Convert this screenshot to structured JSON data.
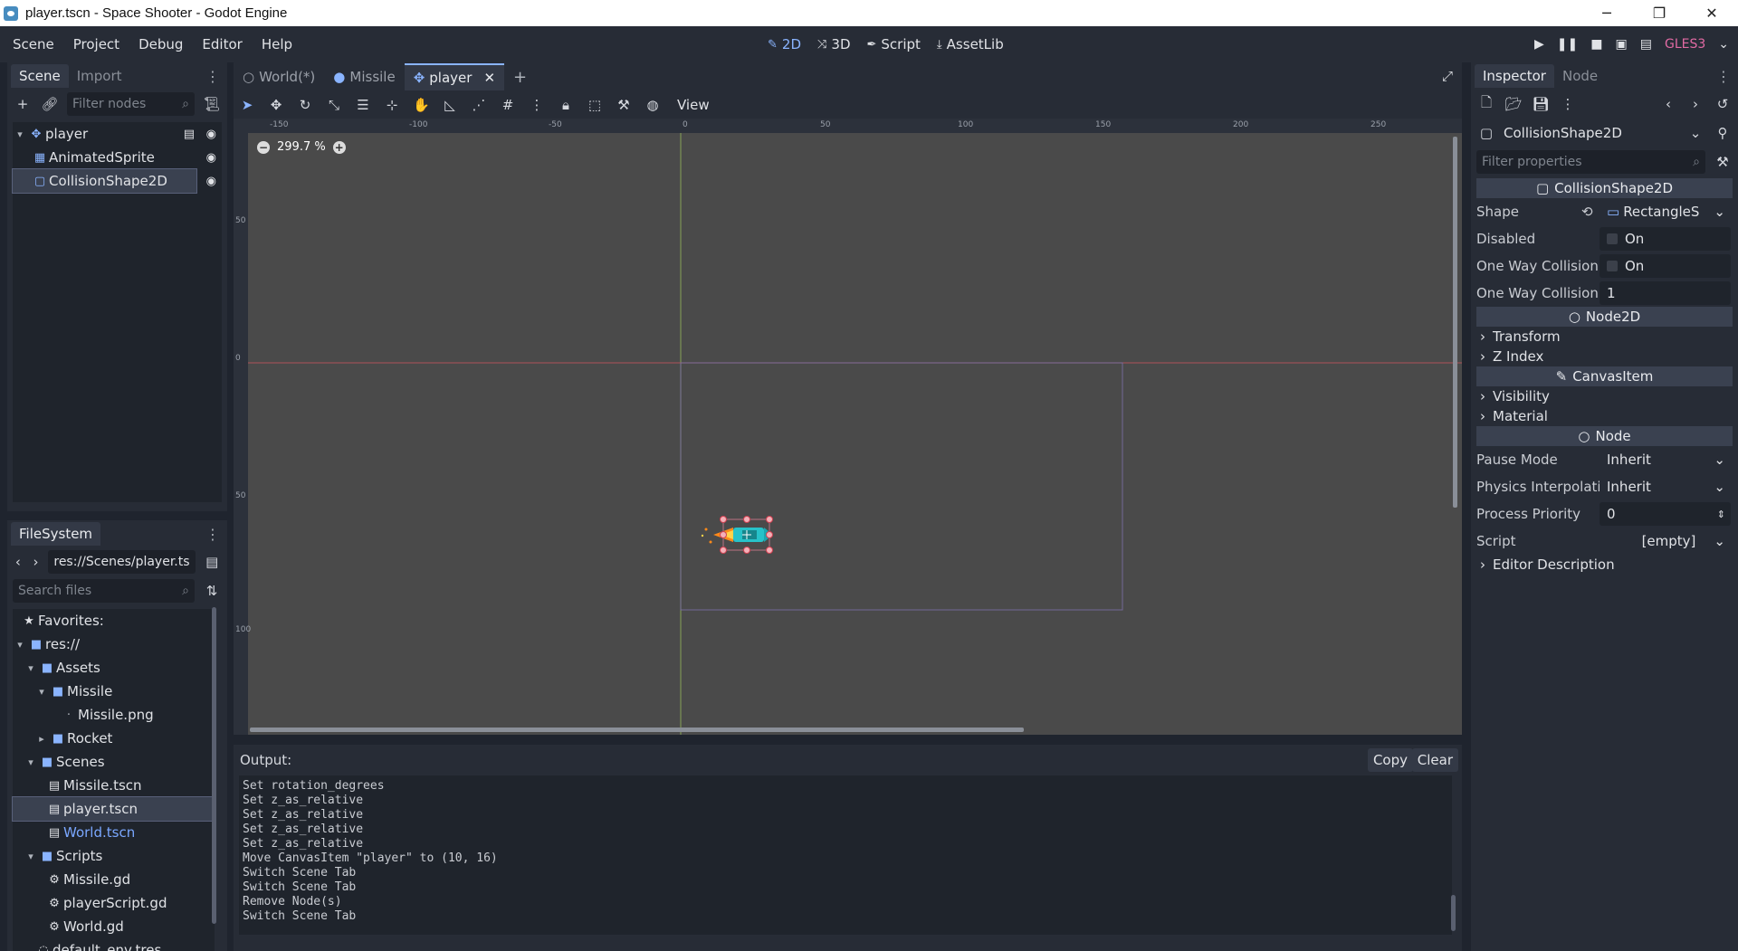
{
  "window": {
    "title": "player.tscn - Space Shooter - Godot Engine",
    "minimize": "─",
    "restore": "❐",
    "close": "✕"
  },
  "menu": [
    "Scene",
    "Project",
    "Debug",
    "Editor",
    "Help"
  ],
  "workspaces": [
    {
      "label": "2D",
      "icon": "✎"
    },
    {
      "label": "3D",
      "icon": "⤨"
    },
    {
      "label": "Script",
      "icon": "✒"
    },
    {
      "label": "AssetLib",
      "icon": "⤓"
    }
  ],
  "renderer": "GLES3",
  "scene_dock": {
    "tabs": [
      "Scene",
      "Import"
    ],
    "filter_placeholder": "Filter nodes",
    "nodes": [
      {
        "name": "player"
      },
      {
        "name": "AnimatedSprite"
      },
      {
        "name": "CollisionShape2D"
      }
    ]
  },
  "filesystem": {
    "title": "FileSystem",
    "path": "res://Scenes/player.ts",
    "search_placeholder": "Search files",
    "items": [
      {
        "label": "Favorites:"
      },
      {
        "label": "res://"
      },
      {
        "label": "Assets"
      },
      {
        "label": "Missile"
      },
      {
        "label": "Missile.png"
      },
      {
        "label": "Rocket"
      },
      {
        "label": "Scenes"
      },
      {
        "label": "Missile.tscn"
      },
      {
        "label": "player.tscn"
      },
      {
        "label": "World.tscn"
      },
      {
        "label": "Scripts"
      },
      {
        "label": "Missile.gd"
      },
      {
        "label": "playerScript.gd"
      },
      {
        "label": "World.gd"
      },
      {
        "label": "default_env.tres"
      }
    ]
  },
  "scene_tabs": [
    "World(*)",
    "Missile",
    "player"
  ],
  "canvas_toolbar": {
    "view": "View"
  },
  "viewport": {
    "zoom": "299.7 %",
    "ruler_top": [
      "-150",
      "-100",
      "-50",
      "0",
      "50",
      "100",
      "150",
      "200",
      "250"
    ],
    "ruler_left": [
      "50",
      "0",
      "50",
      "100"
    ]
  },
  "output": {
    "title": "Output:",
    "copy": "Copy",
    "clear": "Clear",
    "lines": [
      "Set rotation_degrees",
      "Set z_as_relative",
      "Set z_as_relative",
      "Set z_as_relative",
      "Set z_as_relative",
      "Move CanvasItem \"player\" to (10, 16)",
      "Switch Scene Tab",
      "Switch Scene Tab",
      "Remove Node(s)",
      "Switch Scene Tab"
    ]
  },
  "inspector": {
    "tabs": [
      "Inspector",
      "Node"
    ],
    "object": "CollisionShape2D",
    "filter_placeholder": "Filter properties",
    "section_collision": "CollisionShape2D",
    "shape_label": "Shape",
    "shape_value": "RectangleS",
    "disabled_label": "Disabled",
    "disabled_value": "On",
    "one_way_label": "One Way Collision",
    "one_way_value": "On",
    "one_way_margin_label": "One Way Collision",
    "one_way_margin_value": "1",
    "section_node2d": "Node2D",
    "transform": "Transform",
    "z_index": "Z Index",
    "section_canvas": "CanvasItem",
    "visibility": "Visibility",
    "material": "Material",
    "section_node": "Node",
    "pause_label": "Pause Mode",
    "pause_value": "Inherit",
    "physics_label": "Physics Interpolati",
    "physics_value": "Inherit",
    "priority_label": "Process Priority",
    "priority_value": "0",
    "script_label": "Script",
    "script_value": "[empty]",
    "editor_desc": "Editor Description"
  },
  "colors": {
    "accent": "#8ab4ff",
    "x_axis": "#c8555f",
    "y_axis": "#9fc75a"
  }
}
